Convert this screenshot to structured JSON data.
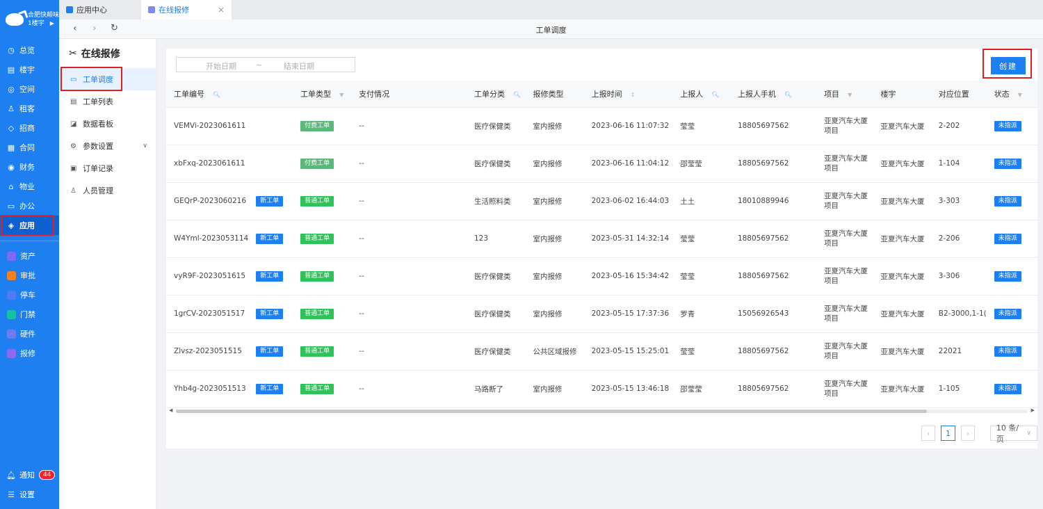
{
  "brand": {
    "name": "合肥快颠味",
    "building": "1楼宇"
  },
  "sidebar": {
    "items": [
      {
        "label": "总览",
        "icon": "dashboard-icon",
        "glyph": "◷"
      },
      {
        "label": "楼宇",
        "icon": "building-icon",
        "glyph": "▤"
      },
      {
        "label": "空间",
        "icon": "space-icon",
        "glyph": "◎"
      },
      {
        "label": "租客",
        "icon": "tenant-icon",
        "glyph": "♙"
      },
      {
        "label": "招商",
        "icon": "merchant-icon",
        "glyph": "◇"
      },
      {
        "label": "合同",
        "icon": "contract-icon",
        "glyph": "▦"
      },
      {
        "label": "财务",
        "icon": "finance-icon",
        "glyph": "◉"
      },
      {
        "label": "物业",
        "icon": "property-icon",
        "glyph": "⌂"
      },
      {
        "label": "办公",
        "icon": "office-icon",
        "glyph": "▭"
      },
      {
        "label": "应用",
        "icon": "app-icon",
        "glyph": "◈"
      }
    ],
    "apps": [
      {
        "label": "资产",
        "icon": "asset-icon",
        "color": "#7b6cf6"
      },
      {
        "label": "审批",
        "icon": "approval-icon",
        "color": "#f5811f"
      },
      {
        "label": "停车",
        "icon": "parking-icon",
        "color": "#4d7cf7"
      },
      {
        "label": "门禁",
        "icon": "access-icon",
        "color": "#19c0a8"
      },
      {
        "label": "硬件",
        "icon": "hardware-icon",
        "color": "#6a7cf0"
      },
      {
        "label": "报修",
        "icon": "repair-icon",
        "color": "#8a6cf0"
      }
    ],
    "notify_label": "通知",
    "notify_count": "44",
    "settings_label": "设置"
  },
  "tabs": [
    {
      "label": "应用中心",
      "color": "#1d7ff0"
    },
    {
      "label": "在线报修",
      "color": "#7d8bf5"
    }
  ],
  "page_title": "工单调度",
  "submenu": {
    "title": "在线报修",
    "items": [
      {
        "label": "工单调度",
        "glyph": "▭"
      },
      {
        "label": "工单列表",
        "glyph": "▤"
      },
      {
        "label": "数据看板",
        "glyph": "◪"
      },
      {
        "label": "参数设置",
        "glyph": "⚙"
      },
      {
        "label": "订单记录",
        "glyph": "▣"
      },
      {
        "label": "人员管理",
        "glyph": "♙"
      }
    ]
  },
  "filters": {
    "start_placeholder": "开始日期",
    "separator": "~",
    "end_placeholder": "结束日期"
  },
  "create_label": "创建",
  "table": {
    "headers": [
      "工单编号",
      "",
      "工单类型",
      "支付情况",
      "工单分类",
      "报修类型",
      "上报时间",
      "上报人",
      "上报人手机",
      "项目",
      "楼宇",
      "对应位置",
      "状态"
    ],
    "rows": [
      {
        "id": "VEMVi-2023061611",
        "new": "",
        "type": "付费工单",
        "paid": true,
        "pay": "--",
        "cat": "医疗保健类",
        "rtype": "室内报修",
        "time": "2023-06-16 11:07:32",
        "reporter": "莹莹",
        "phone": "18805697562",
        "project": "亚夏汽车大厦项目",
        "building": "亚夏汽车大厦",
        "pos": "2-202",
        "status": "未指派"
      },
      {
        "id": "xbFxq-2023061611",
        "new": "",
        "type": "付费工单",
        "paid": true,
        "pay": "--",
        "cat": "医疗保健类",
        "rtype": "室内报修",
        "time": "2023-06-16 11:04:12",
        "reporter": "邵莹莹",
        "phone": "18805697562",
        "project": "亚夏汽车大厦项目",
        "building": "亚夏汽车大厦",
        "pos": "1-104",
        "status": "未指派"
      },
      {
        "id": "GEQrP-2023060216",
        "new": "新工单",
        "type": "普通工单",
        "paid": false,
        "pay": "--",
        "cat": "生活照料类",
        "rtype": "室内报修",
        "time": "2023-06-02 16:44:03",
        "reporter": "土土",
        "phone": "18010889946",
        "project": "亚夏汽车大厦项目",
        "building": "亚夏汽车大厦",
        "pos": "3-303",
        "status": "未指派"
      },
      {
        "id": "W4Yml-2023053114",
        "new": "新工单",
        "type": "普通工单",
        "paid": false,
        "pay": "--",
        "cat": "123",
        "rtype": "室内报修",
        "time": "2023-05-31 14:32:14",
        "reporter": "莹莹",
        "phone": "18805697562",
        "project": "亚夏汽车大厦项目",
        "building": "亚夏汽车大厦",
        "pos": "2-206",
        "status": "未指派"
      },
      {
        "id": "vyR9F-2023051615",
        "new": "新工单",
        "type": "普通工单",
        "paid": false,
        "pay": "--",
        "cat": "医疗保健类",
        "rtype": "室内报修",
        "time": "2023-05-16 15:34:42",
        "reporter": "莹莹",
        "phone": "18805697562",
        "project": "亚夏汽车大厦项目",
        "building": "亚夏汽车大厦",
        "pos": "3-306",
        "status": "未指派"
      },
      {
        "id": "1grCV-2023051517",
        "new": "新工单",
        "type": "普通工单",
        "paid": false,
        "pay": "--",
        "cat": "医疗保健类",
        "rtype": "室内报修",
        "time": "2023-05-15 17:37:36",
        "reporter": "罗青",
        "phone": "15056926543",
        "project": "亚夏汽车大厦项目",
        "building": "亚夏汽车大厦",
        "pos": "B2-3000,1-1(",
        "status": "未指派"
      },
      {
        "id": "Zlvsz-2023051515",
        "new": "新工单",
        "type": "普通工单",
        "paid": false,
        "pay": "--",
        "cat": "医疗保健类",
        "rtype": "公共区域报修",
        "time": "2023-05-15 15:25:01",
        "reporter": "莹莹",
        "phone": "18805697562",
        "project": "亚夏汽车大厦项目",
        "building": "亚夏汽车大厦",
        "pos": "22021",
        "status": "未指派"
      },
      {
        "id": "Yhb4g-2023051513",
        "new": "新工单",
        "type": "普通工单",
        "paid": false,
        "pay": "--",
        "cat": "马路断了",
        "rtype": "室内报修",
        "time": "2023-05-15 13:46:18",
        "reporter": "邵莹莹",
        "phone": "18805697562",
        "project": "亚夏汽车大厦项目",
        "building": "亚夏汽车大厦",
        "pos": "1-105",
        "status": "未指派"
      }
    ]
  },
  "pagination": {
    "current": "1",
    "page_size": "10 条/页"
  }
}
